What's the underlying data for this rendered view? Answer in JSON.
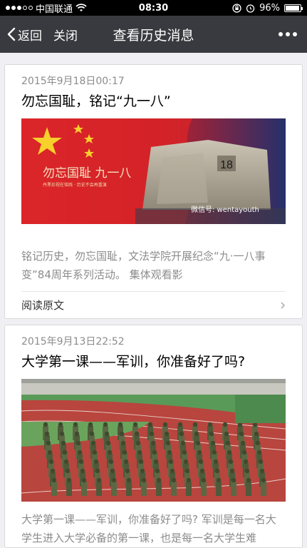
{
  "status": {
    "carrier": "中国联通",
    "time": "08:30",
    "battery": "96%",
    "battery_level": 0.96,
    "icons": [
      "signal-dots-icon",
      "wifi-icon",
      "rotation-lock-icon",
      "alarm-icon",
      "battery-icon"
    ]
  },
  "nav": {
    "back_label": "返回",
    "close_label": "关闭",
    "title": "查看历史消息",
    "more_icon": "more-dots-icon"
  },
  "articles": [
    {
      "date": "2015年9月18日00:17",
      "title": "勿忘国耻，铭记“九一八”",
      "image_caption": "勿忘国耻 九一八",
      "image_subcaption": "丹黑珍视在铭践 · 历史不会再重演",
      "image_watermark": "微信号: wentayouth",
      "image_number": "18",
      "summary": "铭记历史，勿忘国耻，文法学院开展纪念“九·一八事变”84周年系列活动。 集体观看影",
      "read_more": "阅读原文"
    },
    {
      "date": "2015年9月13日22:52",
      "title": "大学第一课——军训，你准备好了吗?",
      "summary": "大学第一课——军训，你准备好了吗? 军训是每一名大学生进入大学必备的第一课，也是每一名大学生难"
    }
  ],
  "colors": {
    "navbar": "#393a3f",
    "background": "#efeff4",
    "date_text": "#8c8c8c",
    "flag_red": "#d7262c",
    "track_red": "#b8453e"
  }
}
